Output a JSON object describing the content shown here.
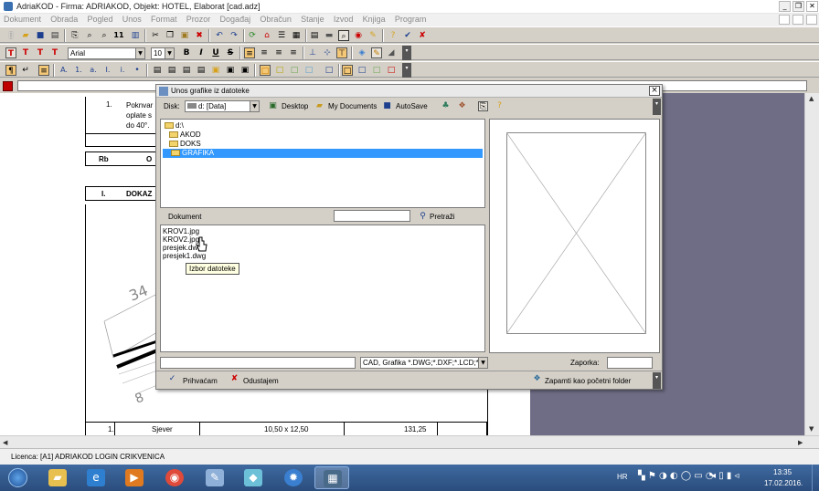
{
  "window": {
    "title": "AdriaKOD - Firma: ADRIAKOD,  Objekt: HOTEL, Elaborat [cad.adz]",
    "controls": {
      "minimize": "_",
      "restore": "❐",
      "close": "✕"
    }
  },
  "menu": [
    "Dokument",
    "Obrada",
    "Pogled",
    "Unos",
    "Format",
    "Prozor",
    "Događaj",
    "Obračun",
    "Stanje",
    "Izvod",
    "Knjiga",
    "Program"
  ],
  "format_toolbar": {
    "font_name": "Arial",
    "font_size": "10",
    "bold": "B",
    "italic": "I",
    "underline": "U",
    "strike": "S"
  },
  "toolbar1_small": {
    "page_num": "11"
  },
  "document": {
    "row1_num": "1.",
    "row1_text": [
      "Poknvar",
      "oplate s",
      "do 40°."
    ],
    "hdr_rb": "Rb",
    "hdr_o": "O",
    "sect_num": "I.",
    "sect_text": "DOKAZ",
    "drawing_dim1": "34",
    "drawing_dim2": "8",
    "bottom_row": {
      "num": "1.",
      "side": "Sjever",
      "dims": "10,50 x 12,50",
      "area": "131,25"
    }
  },
  "dialog": {
    "title": "Unos grafike iz datoteke",
    "disk_label": "Disk:",
    "disk_value": "d: [Data]",
    "desktop": "Desktop",
    "my_documents": "My Documents",
    "autosave": "AutoSave",
    "folders": [
      {
        "name": "d:\\",
        "selected": false,
        "indent": 0
      },
      {
        "name": "AKOD",
        "selected": false,
        "indent": 1
      },
      {
        "name": "DOKS",
        "selected": false,
        "indent": 1
      },
      {
        "name": "GRAFIKA",
        "selected": true,
        "indent": 1
      }
    ],
    "dokument_label": "Dokument",
    "search_button": "Pretraži",
    "files": [
      "KROV1.jpg",
      "KROV2.jpg",
      "presjek.dwg",
      "presjek1.dwg"
    ],
    "tooltip": "Izbor datoteke",
    "filter_value": "CAD, Grafika *.DWG;*.DXF;*.LCD;*.",
    "password_label": "Zaporka:",
    "ok_button": "Prihvaćam",
    "cancel_button": "Odustajem",
    "remember_button": "Zapamti kao početni folder"
  },
  "status": {
    "text": "Licenca: [A1] ADRIAKOD LOGIN CRIKVENICA"
  },
  "taskbar": {
    "lang": "HR",
    "time": "13:35",
    "date": "17.02.2016."
  },
  "colors": {
    "red_square": "#c00000",
    "selection": "#3399ff",
    "dark_pane": "#6f6d85",
    "taskbar": "#2a4d7c"
  }
}
